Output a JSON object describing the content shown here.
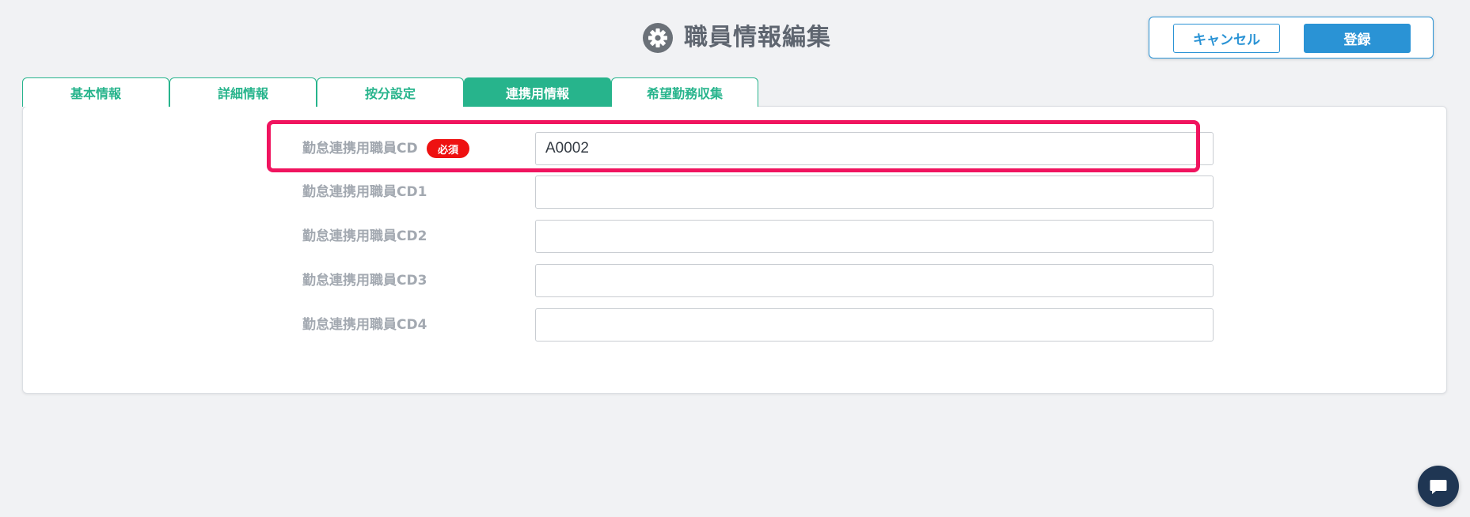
{
  "header": {
    "title": "職員情報編集",
    "icon": "gear-icon"
  },
  "actions": {
    "cancel_label": "キャンセル",
    "save_label": "登録"
  },
  "tabs": [
    {
      "label": "基本情報",
      "active": false
    },
    {
      "label": "詳細情報",
      "active": false
    },
    {
      "label": "按分設定",
      "active": false
    },
    {
      "label": "連携用情報",
      "active": true
    },
    {
      "label": "希望勤務収集",
      "active": false
    }
  ],
  "form": {
    "required_badge": "必須",
    "fields": [
      {
        "label": "勤怠連携用職員CD",
        "value": "A0002",
        "required": true
      },
      {
        "label": "勤怠連携用職員CD1",
        "value": "",
        "required": false
      },
      {
        "label": "勤怠連携用職員CD2",
        "value": "",
        "required": false
      },
      {
        "label": "勤怠連携用職員CD3",
        "value": "",
        "required": false
      },
      {
        "label": "勤怠連携用職員CD4",
        "value": "",
        "required": false
      }
    ]
  },
  "chat": {
    "icon": "chat-bubble-icon"
  },
  "colors": {
    "tab_accent": "#27b48c",
    "button_accent": "#2a93d5",
    "required_badge": "#ee1111",
    "highlight_frame": "#f0145f",
    "chat_button": "#1f3653"
  }
}
